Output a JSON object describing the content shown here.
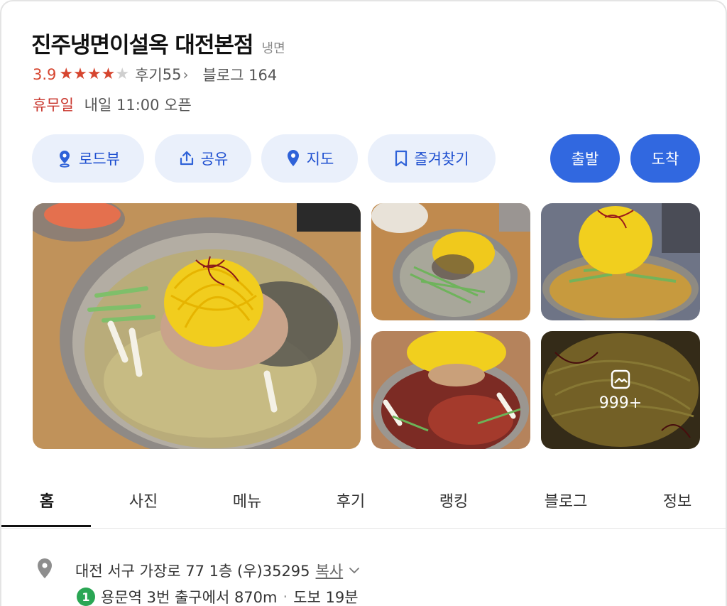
{
  "place": {
    "name": "진주냉면이설옥 대전본점",
    "category": "냉면",
    "rating": "3.9",
    "rating_value": 3.9,
    "stars_filled": 4,
    "stars_total": 5,
    "review_label": "후기",
    "review_count": "55",
    "blog_label": "블로그",
    "blog_count": "164",
    "closed_label": "휴무일",
    "hours_text": "내일 11:00 오픈"
  },
  "actions": {
    "roadview": "로드뷰",
    "share": "공유",
    "map": "지도",
    "favorite": "즐겨찾기",
    "depart": "출발",
    "arrive": "도착"
  },
  "photos": {
    "more_count": "999+"
  },
  "tabs": [
    "홈",
    "사진",
    "메뉴",
    "후기",
    "랭킹",
    "블로그",
    "정보"
  ],
  "active_tab": "홈",
  "address": {
    "text": "대전 서구 가장로 77 1층 (우)35295",
    "copy_label": "복사"
  },
  "transit": {
    "line": "1",
    "line_color": "#2aa654",
    "station_text": "용문역 3번 출구에서 870m",
    "walk_text": "도보 19분"
  },
  "colors": {
    "accent": "#3168e0",
    "rating": "#d6452f",
    "closed": "#c9362d",
    "button_bg": "#eaf0fb"
  }
}
